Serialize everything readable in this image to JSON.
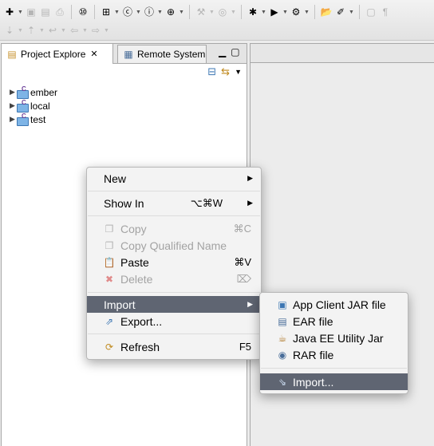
{
  "toolbar": {
    "row1": [
      {
        "icon": "new-wizard-icon",
        "glyph": "✚",
        "dropdown": true
      },
      {
        "icon": "save-icon",
        "glyph": "▣",
        "disabled": true
      },
      {
        "icon": "save-all-icon",
        "glyph": "▤",
        "disabled": true
      },
      {
        "icon": "print-icon",
        "glyph": "⎙",
        "disabled": true
      },
      {
        "sep": true
      },
      {
        "icon": "open-type-icon",
        "glyph": "⑩"
      },
      {
        "sep": true
      },
      {
        "icon": "new-package-icon",
        "glyph": "⊞",
        "dropdown": true
      },
      {
        "icon": "new-class-icon",
        "glyph": "ⓒ",
        "dropdown": true
      },
      {
        "icon": "new-interface-icon",
        "glyph": "ⓘ",
        "dropdown": true
      },
      {
        "icon": "new-enum-icon",
        "glyph": "⊕",
        "dropdown": true
      },
      {
        "sep": true
      },
      {
        "icon": "build-icon",
        "glyph": "⚒",
        "dropdown": true,
        "disabled": true
      },
      {
        "icon": "target-icon",
        "glyph": "◎",
        "dropdown": true,
        "disabled": true
      },
      {
        "sep": true
      },
      {
        "icon": "debug-icon",
        "glyph": "✱",
        "dropdown": true
      },
      {
        "icon": "run-icon",
        "glyph": "▶",
        "dropdown": true
      },
      {
        "icon": "external-tools-icon",
        "glyph": "⚙",
        "dropdown": true
      },
      {
        "sep": true
      },
      {
        "icon": "open-folder-icon",
        "glyph": "📂"
      },
      {
        "icon": "open-task-icon",
        "glyph": "✐",
        "dropdown": true
      },
      {
        "sep": true
      },
      {
        "icon": "toggle-mark-icon",
        "glyph": "▢",
        "disabled": true
      },
      {
        "icon": "show-whitespace-icon",
        "glyph": "¶",
        "disabled": true
      }
    ],
    "row2": [
      {
        "icon": "next-annotation-icon",
        "glyph": "⇣",
        "dropdown": true,
        "disabled": true
      },
      {
        "icon": "prev-annotation-icon",
        "glyph": "⇡",
        "dropdown": true,
        "disabled": true
      },
      {
        "icon": "last-edit-icon",
        "glyph": "↩",
        "dropdown": true,
        "disabled": true
      },
      {
        "icon": "back-icon",
        "glyph": "⇦",
        "dropdown": true,
        "disabled": true
      },
      {
        "icon": "forward-icon",
        "glyph": "⇨",
        "dropdown": true,
        "disabled": true
      }
    ]
  },
  "explorer": {
    "tab_label": "Project Explore",
    "tab_close": "✕",
    "other_tab_label": "Remote System",
    "projects": [
      {
        "name": "ember"
      },
      {
        "name": "local"
      },
      {
        "name": "test"
      }
    ]
  },
  "context_menu": {
    "new": "New",
    "show_in": "Show In",
    "show_in_shortcut": "⌥⌘W",
    "copy": "Copy",
    "copy_shortcut": "⌘C",
    "copy_qualified": "Copy Qualified Name",
    "paste": "Paste",
    "paste_shortcut": "⌘V",
    "delete": "Delete",
    "delete_shortcut": "⌦",
    "import": "Import",
    "export": "Export...",
    "refresh": "Refresh",
    "refresh_shortcut": "F5"
  },
  "import_submenu": {
    "app_client": "App Client JAR file",
    "ear": "EAR file",
    "utility_jar": "Java EE Utility Jar",
    "rar": "RAR file",
    "import": "Import..."
  },
  "colors": {
    "highlight": "#5f6572",
    "menu_bg": "#f3f3f3",
    "disabled_text": "#a3a3a3"
  }
}
